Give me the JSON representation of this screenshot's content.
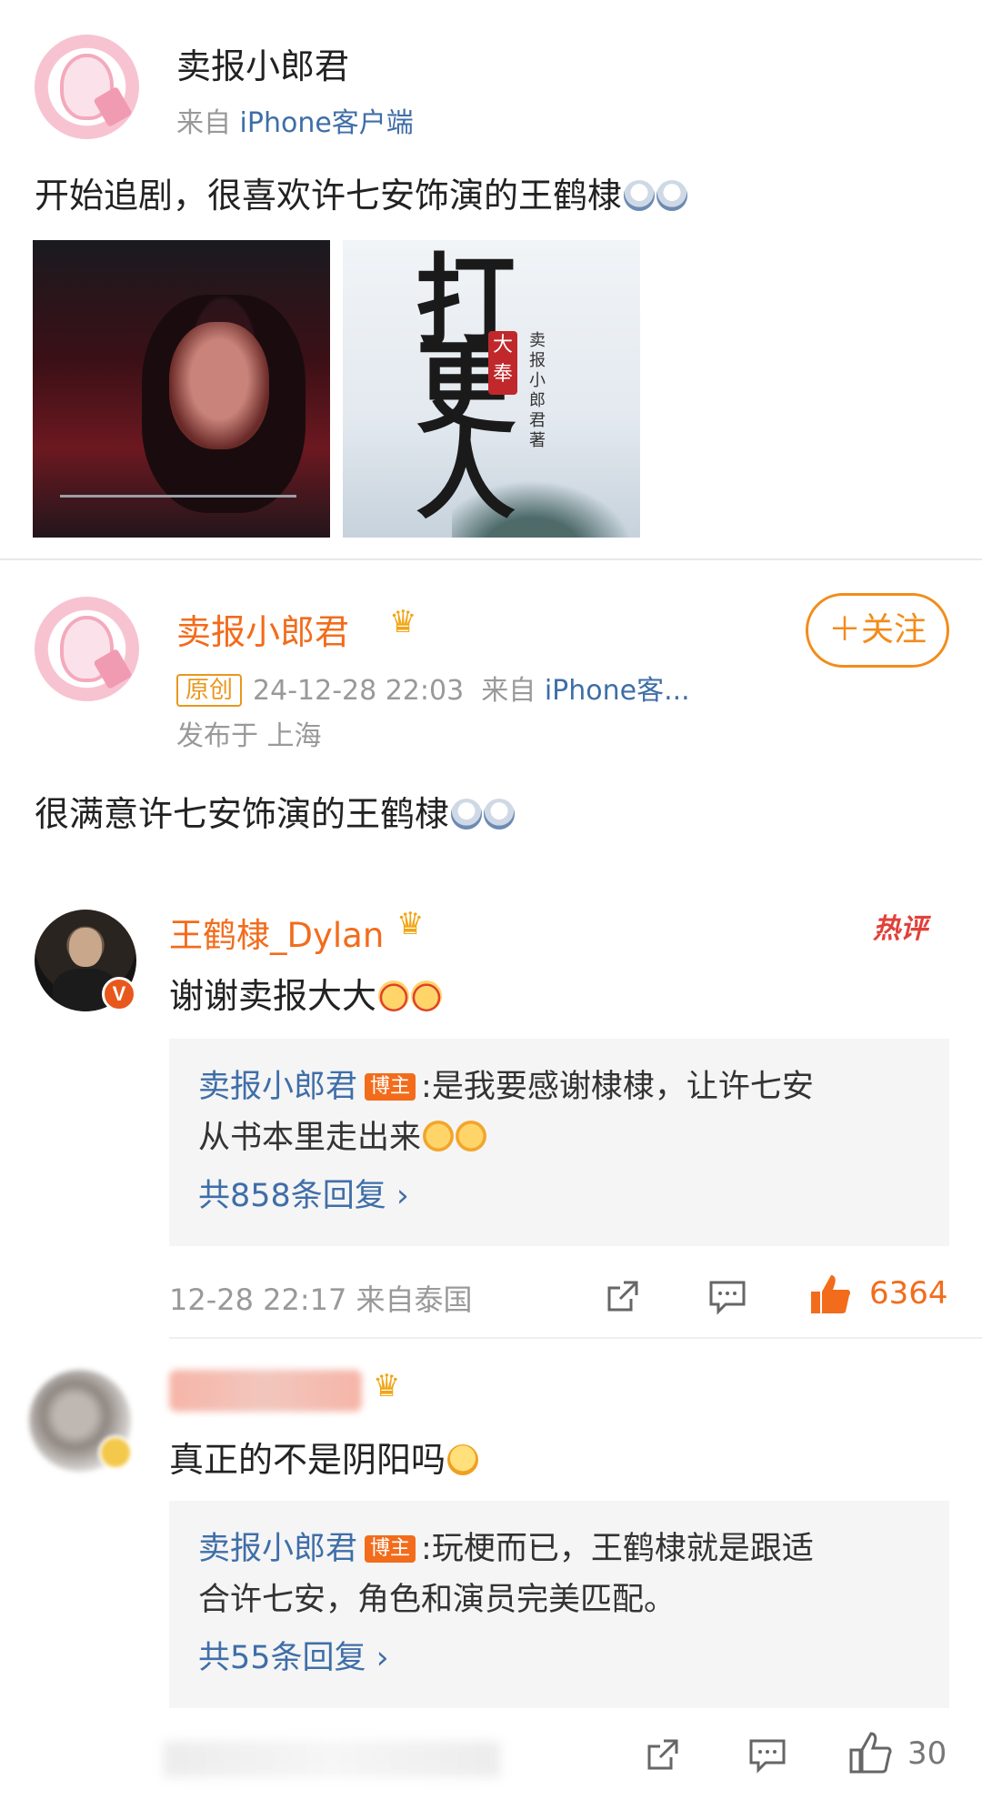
{
  "post1": {
    "username": "卖报小郎君",
    "source_prefix": "来自",
    "source_client": "iPhone客户端",
    "body": "开始追剧，很喜欢许七安饰演的王鹤棣",
    "images": [
      "tv-still",
      "book-cover"
    ]
  },
  "post2": {
    "username": "卖报小郎君",
    "follow_label": "＋关注",
    "original_badge": "原创",
    "timestamp": "24-12-28 22:03",
    "source_prefix": "来自",
    "source_client": "iPhone客...",
    "location": "发布于 上海",
    "body": "很满意许七安饰演的王鹤棣"
  },
  "comments": [
    {
      "username": "王鹤棣_Dylan",
      "verified": "V",
      "hot_tag": "热评",
      "text": "谢谢卖报大大",
      "reply": {
        "author": "卖报小郎君",
        "badge": "博主",
        "line1": ":是我要感谢棣棣，让许七安",
        "line2": "从书本里走出来",
        "count_label": "共858条回复 ›"
      },
      "meta": "12-28 22:17 来自泰国",
      "likes": "6364"
    },
    {
      "username": "",
      "text": "真正的不是阴阳吗",
      "reply": {
        "author": "卖报小郎君",
        "badge": "博主",
        "line1": ":玩梗而已，王鹤棣就是跟适",
        "line2": "合许七安，角色和演员完美匹配。",
        "count_label": "共55条回复 ›"
      },
      "likes": "30"
    }
  ],
  "colors": {
    "accent_orange": "#f26c1c",
    "link_blue": "#3f6ea8",
    "follow_orange": "#f28c1b",
    "hot_red": "#e0413a"
  },
  "icons": {
    "crown": "crown-icon",
    "share": "share-icon",
    "comment": "comment-icon",
    "like": "thumbs-up-icon"
  }
}
